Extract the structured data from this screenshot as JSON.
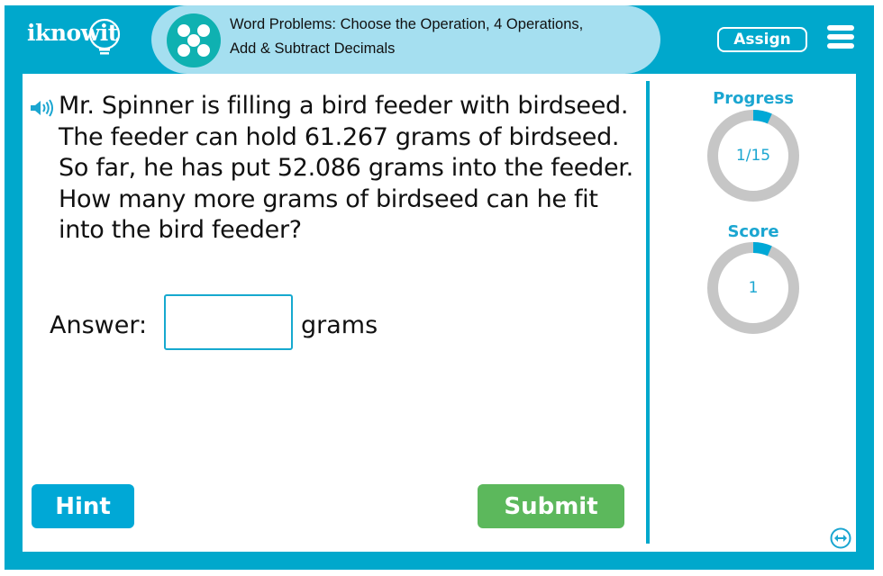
{
  "header": {
    "logo_text": "iknowit",
    "title": "Word Problems: Choose the Operation, 4 Operations, Add & Subtract Decimals",
    "assign_label": "Assign",
    "menu_icon": "hamburger-menu-icon",
    "activity_icon": "five-dots-icon"
  },
  "question": {
    "speaker_icon": "speaker-icon",
    "text": "Mr. Spinner is filling a bird feeder with birdseed. The feeder can hold 61.267 grams of birdseed. So far, he has put 52.086 grams into the feeder. How many more grams of birdseed can he fit into the bird feeder?"
  },
  "answer": {
    "label": "Answer:",
    "value": "",
    "placeholder": "",
    "unit": "grams"
  },
  "buttons": {
    "hint_label": "Hint",
    "submit_label": "Submit"
  },
  "sidebar": {
    "progress": {
      "label": "Progress",
      "value_text": "1/15",
      "current": 1,
      "total": 15
    },
    "score": {
      "label": "Score",
      "value_text": "1",
      "fill_fraction": 0.0667
    },
    "resize_icon": "double-arrow-icon"
  },
  "colors": {
    "frame": "#00a8cc",
    "header_pill": "#a5dff0",
    "accent_text": "#1ba6d1",
    "hint_button": "#00a8d6",
    "submit_button": "#5cb85c",
    "ring_track": "#c6c6c6",
    "ring_fill": "#00a8d6",
    "activity_icon_bg": "#0fb1b1"
  }
}
